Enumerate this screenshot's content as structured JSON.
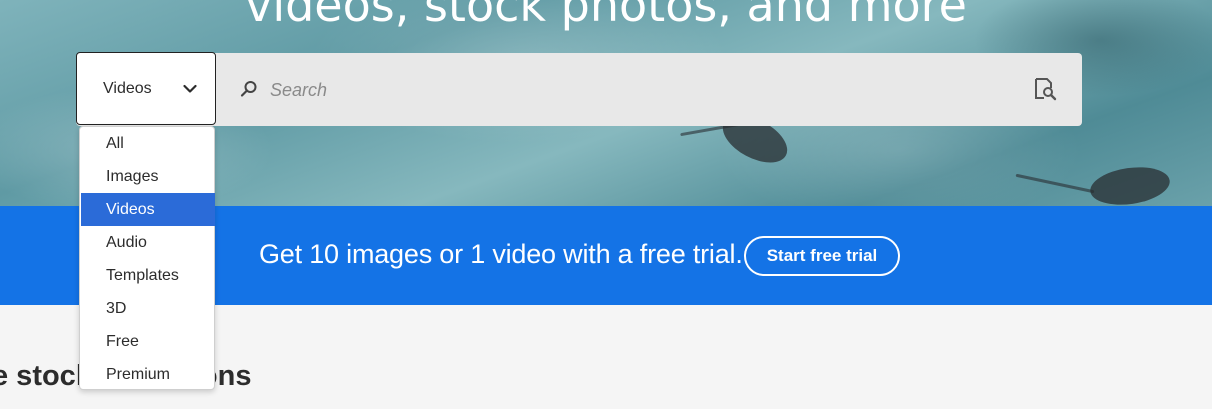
{
  "hero": {
    "title": "videos, stock photos, and more"
  },
  "search": {
    "type_selected": "Videos",
    "placeholder": "Search",
    "value": ""
  },
  "dropdown": {
    "options": [
      "All",
      "Images",
      "Videos",
      "Audio",
      "Templates",
      "3D",
      "Free",
      "Premium"
    ],
    "selected_index": 2
  },
  "banner": {
    "text": "Get 10 images or 1 video with a free trial.",
    "button_label": "Start free trial"
  },
  "section": {
    "heading": "e stock collections"
  },
  "colors": {
    "banner_blue": "#1473e6",
    "selected_blue": "#2b6bd8",
    "search_bg": "#e8e8e8"
  },
  "icons": {
    "search": "search-icon",
    "chevron": "chevron-down-icon",
    "visual_search": "visual-search-icon"
  }
}
